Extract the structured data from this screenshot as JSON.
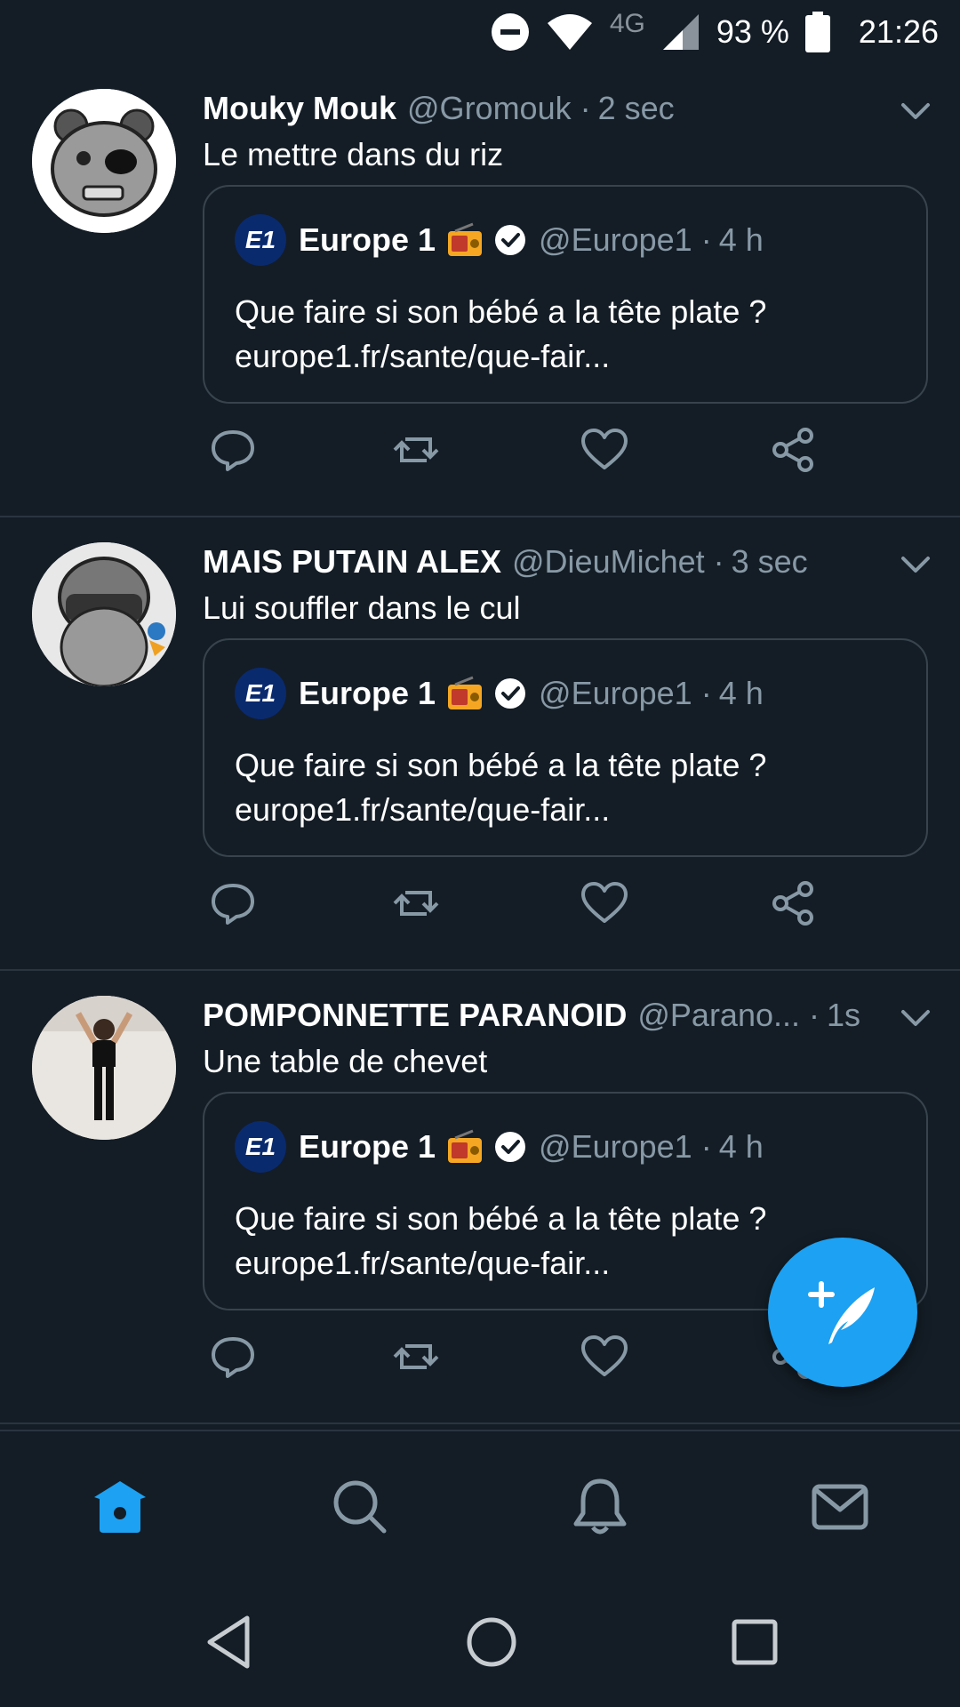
{
  "status_bar": {
    "network": "4G",
    "battery": "93 %",
    "time": "21:26",
    "icons": [
      "do-not-disturb-icon",
      "wifi-icon",
      "signal-icon",
      "battery-icon"
    ]
  },
  "tweets": [
    {
      "name": "Mouky Mouk",
      "handle": "@Gromouk",
      "sep": "·",
      "time": "2 sec",
      "text": "Le mettre dans du riz",
      "quote": {
        "logo": "E1",
        "name": "Europe 1",
        "handle": "@Europe1",
        "sep": "·",
        "time": "4 h",
        "text_line1": "Que faire si son bébé a la tête plate ?",
        "text_line2": "europe1.fr/sante/que-fair..."
      }
    },
    {
      "name": "MAIS PUTAIN ALEX",
      "handle": "@DieuMichet",
      "sep": "·",
      "time": "3 sec",
      "text": "Lui souffler dans le cul",
      "quote": {
        "logo": "E1",
        "name": "Europe 1",
        "handle": "@Europe1",
        "sep": "·",
        "time": "4 h",
        "text_line1": "Que faire si son bébé a la tête plate ?",
        "text_line2": "europe1.fr/sante/que-fair..."
      }
    },
    {
      "name": "POMPONNETTE PARANOID",
      "handle": "@Parano...",
      "sep": "·",
      "time": "1s",
      "text": "Une table de chevet",
      "quote": {
        "logo": "E1",
        "name": "Europe 1",
        "handle": "@Europe1",
        "sep": "·",
        "time": "4 h",
        "text_line1": "Que faire si son bébé a la tête plate ?",
        "text_line2": "europe1.fr/sante/que-fair..."
      }
    }
  ],
  "colors": {
    "background": "#141d26",
    "accent": "#1da1f2",
    "secondary_text": "#8899a6",
    "border": "#38444d"
  },
  "bottom_nav": {
    "items": [
      "home-icon",
      "search-icon",
      "notifications-icon",
      "messages-icon"
    ],
    "active": "home-icon"
  },
  "system_nav": [
    "back-icon",
    "home-circle-icon",
    "recents-icon"
  ]
}
